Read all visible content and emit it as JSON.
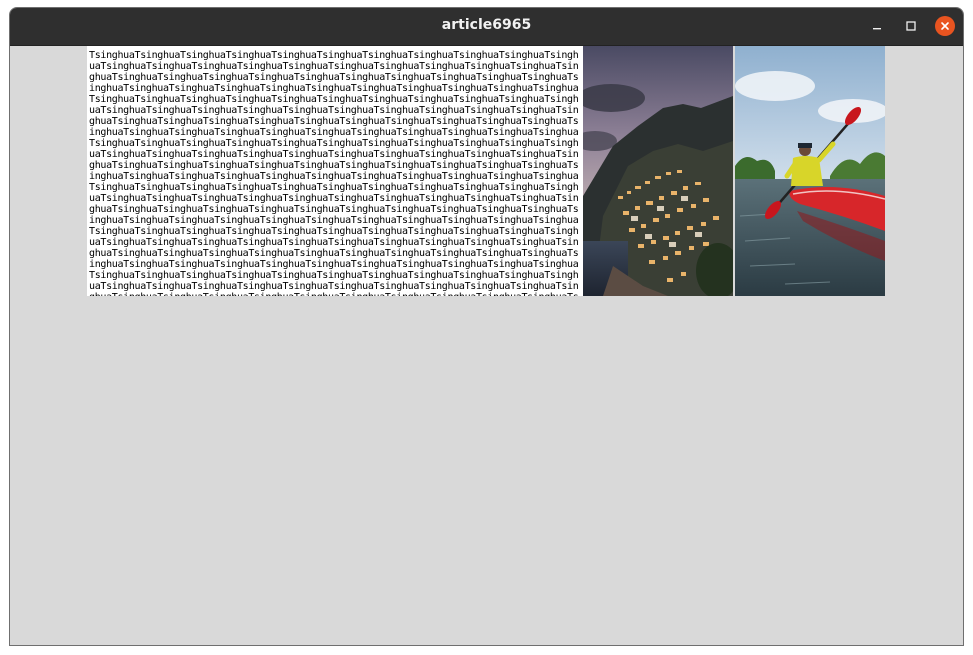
{
  "window": {
    "title": "article6965",
    "controls": {
      "minimize_icon": "minimize-icon",
      "maximize_icon": "maximize-icon",
      "close_icon": "close-icon",
      "close_color": "#e95420"
    }
  },
  "article": {
    "text_block": "TsinghuaTsinghuaTsinghuaTsinghuaTsinghuaTsinghuaTsinghuaTsinghuaTsinghuaTsinghuaTsinghuaTsinghuaTsinghuaTsinghuaTsinghuaTsinghuaTsinghuaTsinghuaTsinghuaTsinghuaTsinghuaTsinghuaTsinghuaTsinghuaTsinghuaTsinghuaTsinghuaTsinghuaTsinghuaTsinghuaTsinghuaTsinghuaTsinghuaTsinghuaTsinghuaTsinghuaTsinghuaTsinghuaTsinghuaTsinghuaTsinghuaTsinghuaTsinghuaTsinghuaTsinghuaTsinghuaTsinghuaTsinghuaTsinghuaTsinghuaTsinghuaTsinghuaTsinghuaTsinghuaTsinghuaTsinghuaTsinghuaTsinghuaTsinghuaTsinghuaTsinghuaTsinghuaTsinghuaTsinghuaTsinghuaTsinghuaTsinghuaTsinghuaTsinghuaTsinghuaTsinghuaTsinghuaTsinghuaTsinghuaTsinghuaTsinghuaTsinghuaTsinghuaTsinghuaTsinghuaTsinghuaTsinghuaTsinghuaTsinghuaTsinghuaTsinghuaTsinghuaTsinghuaTsinghuaTsinghuaTsinghuaTsinghuaTsinghuaTsinghuaTsinghuaTsinghuaTsinghuaTsinghuaTsinghuaTsinghuaTsinghuaTsinghuaTsinghuaTsinghuaTsinghuaTsinghuaTsinghuaTsinghuaTsinghuaTsinghuaTsinghuaTsinghuaTsinghuaTsinghuaTsinghuaTsinghuaTsinghuaTsinghuaTsinghuaTsinghuaTsinghuaTsinghuaTsinghuaTsinghuaTsinghuaTsinghuaTsinghuaTsinghuaTsinghuaTsinghuaTsinghuaTsinghuaTsinghuaTsinghuaTsinghuaTsinghuaTsinghuaTsinghuaTsinghuaTsinghuaTsinghuaTsinghuaTsinghuaTsinghuaTsinghuaTsinghuaTsinghuaTsinghuaTsinghuaTsinghuaTsinghuaTsinghuaTsinghuaTsinghuaTsinghuaTsinghuaTsinghuaTsinghuaTsinghuaTsinghuaTsinghuaTsinghuaTsinghuaTsinghuaTsinghuaTsinghuaTsinghuaTsinghuaTsinghuaTsinghuaTsinghuaTsinghuaTsinghuaTsinghuaTsinghuaTsinghuaTsinghuaTsinghuaTsinghuaTsinghuaTsinghuaTsinghuaTsinghuaTsinghuaTsinghuaTsinghuaTsinghuaTsinghuaTsinghuaTsinghuaTsinghuaTsinghuaTsinghuaTsinghuaTsinghuaTsinghuaTsinghuaTsinghuaTsinghuaTsinghuaTsinghuaTsinghuaTsinghuaTsinghuaTsinghuaTsinghuaTsinghuaTsinghuaTsinghuaTsinghuaTsinghuaTsinghuaTsinghuaTsinghuaTsinghuaTsinghuaTsinghuaTsinghuaTsinghuaTsinghuaTsinghuaTsinghuaTsinghuaTsinghuaTsinghuaTsinghuaTsinghuaTsinghuaTsinghuaTsinghuaTsinghuaTsinghuaTsinghuaTsinghuaTsinghuaTsinghuaTsinghuaTsinghuaTsinghuaTsinghuaTsinghuaTsinghuaTsinghuaTsinghuaTsinghuaTsinghuaTsinghuaTsinghuaTsinghuaTsinghuaTsinghuaTsinghuaTsinghuaTsinghuaTsinghuaTsinghuaTsinghuaTsinghuaTsinghuaTsinghuaTsinghuaTsinghuaTsinghuaTsinghuaTsinghuaTsinghuaTsinghuaTsinghuaTsinghuaTsinghuaTsinghuaTsinghuaTsinghuaTsinghuaTsinghuaTsinghuaTsinghuaTsinghuaTsin",
    "images": [
      {
        "name": "coastal-town-at-dusk-image"
      },
      {
        "name": "kayaker-on-river-image"
      }
    ]
  }
}
